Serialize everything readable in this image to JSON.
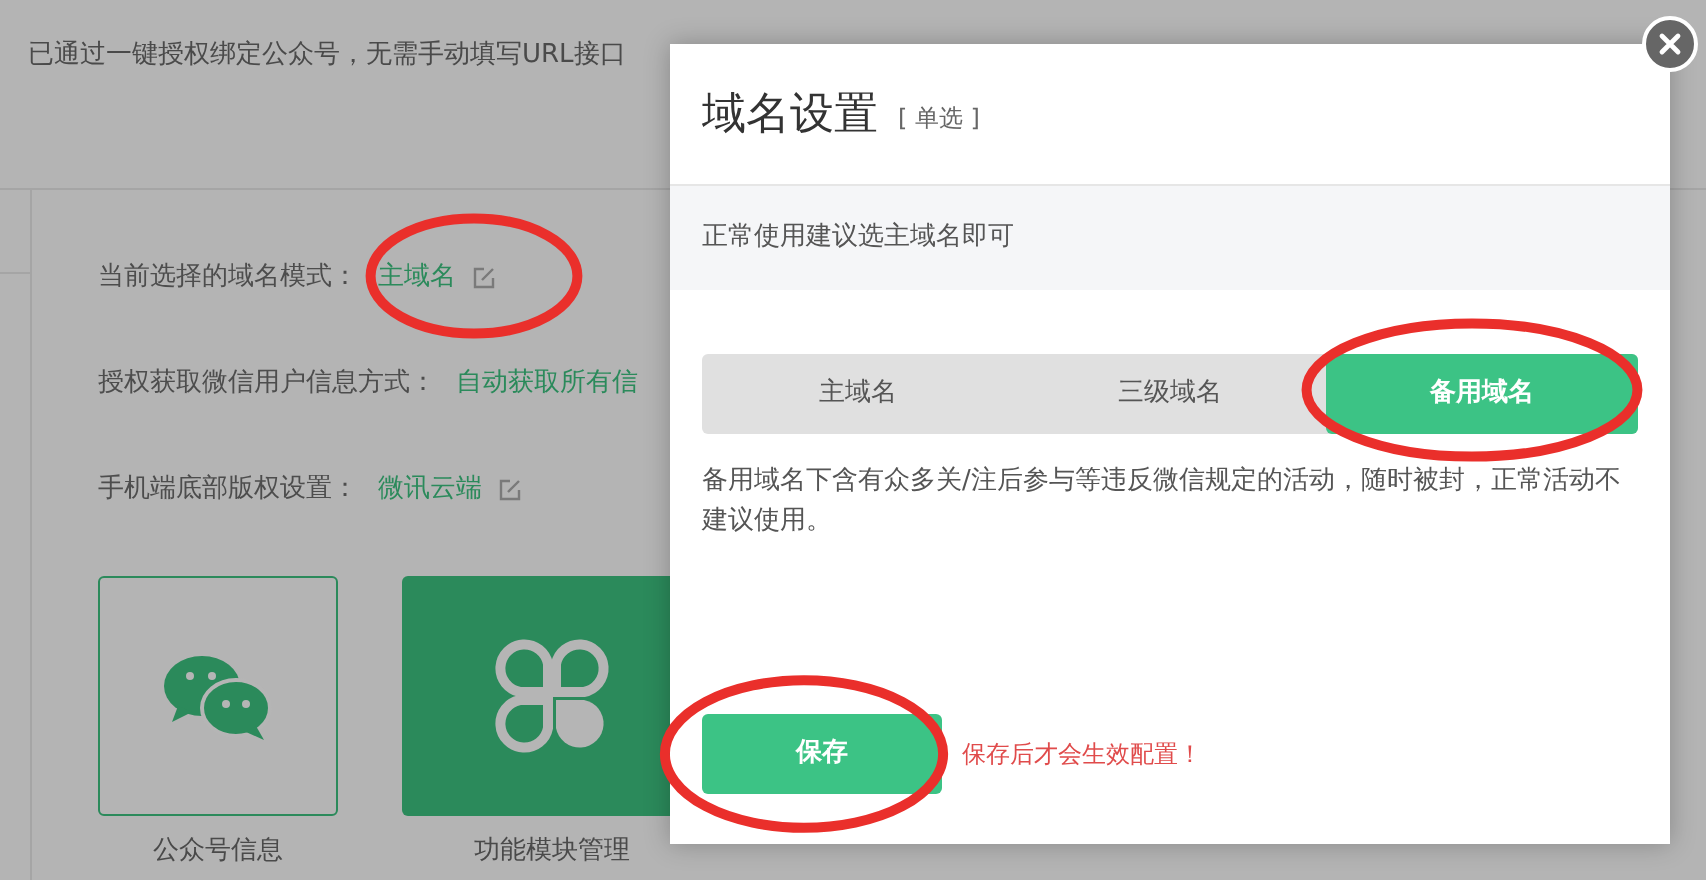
{
  "page": {
    "notice": "已通过一键授权绑定公众号，无需手动填写URL接口",
    "settings": [
      {
        "label": "当前选择的域名模式：",
        "value": "主域名",
        "edit_icon": true
      },
      {
        "label": "授权获取微信用户信息方式：",
        "value": "自动获取所有信",
        "edit_icon": false
      },
      {
        "label": "手机端底部版权设置：",
        "value": "微讯云端",
        "edit_icon": true
      }
    ],
    "cards": [
      {
        "kind": "outline",
        "label": "公众号信息"
      },
      {
        "kind": "filled",
        "label": "功能模块管理"
      }
    ]
  },
  "modal": {
    "title": "域名设置",
    "tag": "[ 单选 ]",
    "tip": "正常使用建议选主域名即可",
    "options": [
      {
        "label": "主域名",
        "selected": false
      },
      {
        "label": "三级域名",
        "selected": false
      },
      {
        "label": "备用域名",
        "selected": true
      }
    ],
    "description": "备用域名下含有众多关/注后参与等违反微信规定的活动，随时被封，正常活动不建议使用。",
    "save_button": "保存",
    "save_note": "保存后才会生效配置！"
  }
}
